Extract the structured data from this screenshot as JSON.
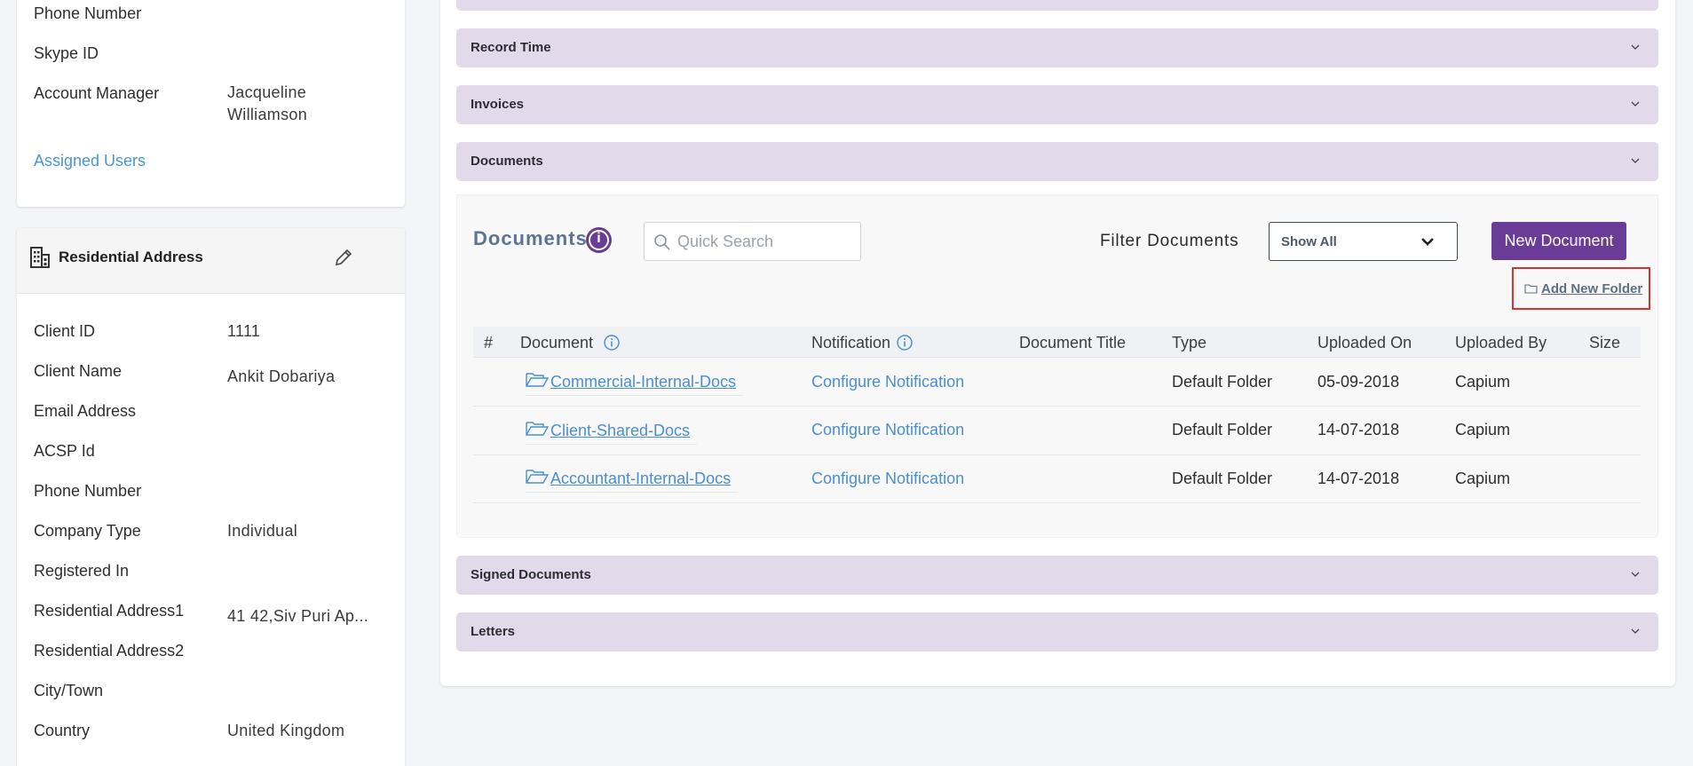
{
  "profile": {
    "rows": [
      {
        "label": "Phone Number",
        "value": ""
      },
      {
        "label": "Skype ID",
        "value": ""
      },
      {
        "label": "Account Manager",
        "value_line1": "Jacqueline",
        "value_line2": "Williamson"
      }
    ],
    "assigned_users": "Assigned Users"
  },
  "residential": {
    "title": "Residential Address",
    "rows": [
      {
        "label": "Client ID",
        "value": "1111"
      },
      {
        "label": "Client Name",
        "value": "Ankit Dobariya"
      },
      {
        "label": "Email Address",
        "value": ""
      },
      {
        "label": "ACSP Id",
        "value": ""
      },
      {
        "label": "Phone Number",
        "value": ""
      },
      {
        "label": "Company Type",
        "value": "Individual"
      },
      {
        "label": "Registered In",
        "value": ""
      },
      {
        "label": "Residential Address1",
        "value": "41 42,Siv Puri Ap..."
      },
      {
        "label": "Residential Address2",
        "value": ""
      },
      {
        "label": "City/Town",
        "value": ""
      },
      {
        "label": "Country",
        "value": "United Kingdom"
      }
    ]
  },
  "accordions": {
    "record_time": "Record Time",
    "invoices": "Invoices",
    "documents": "Documents",
    "signed_documents": "Signed Documents",
    "letters": "Letters"
  },
  "documents": {
    "title": "Documents",
    "info_glyph": "i",
    "search_placeholder": "Quick Search",
    "filter_label": "Filter Documents",
    "filter_value": "Show All",
    "new_document": "New Document",
    "add_new_folder": "Add New Folder",
    "columns": [
      "#",
      "Document",
      "Notification",
      "Document Title",
      "Type",
      "Uploaded On",
      "Uploaded By",
      "Size"
    ],
    "rows": [
      {
        "name": "Commercial-Internal-Docs",
        "notification": "Configure Notification",
        "title": "",
        "type": "Default Folder",
        "uploaded_on": "05-09-2018",
        "uploaded_by": "Capium",
        "size": ""
      },
      {
        "name": "Client-Shared-Docs",
        "notification": "Configure Notification",
        "title": "",
        "type": "Default Folder",
        "uploaded_on": "14-07-2018",
        "uploaded_by": "Capium",
        "size": ""
      },
      {
        "name": "Accountant-Internal-Docs",
        "notification": "Configure Notification",
        "title": "",
        "type": "Default Folder",
        "uploaded_on": "14-07-2018",
        "uploaded_by": "Capium",
        "size": ""
      }
    ]
  },
  "colors": {
    "accent_purple": "#6a3c97",
    "accordion_bg": "#e2d9ea",
    "link_blue": "#4a8fd3",
    "highlight_red": "#d63232"
  }
}
